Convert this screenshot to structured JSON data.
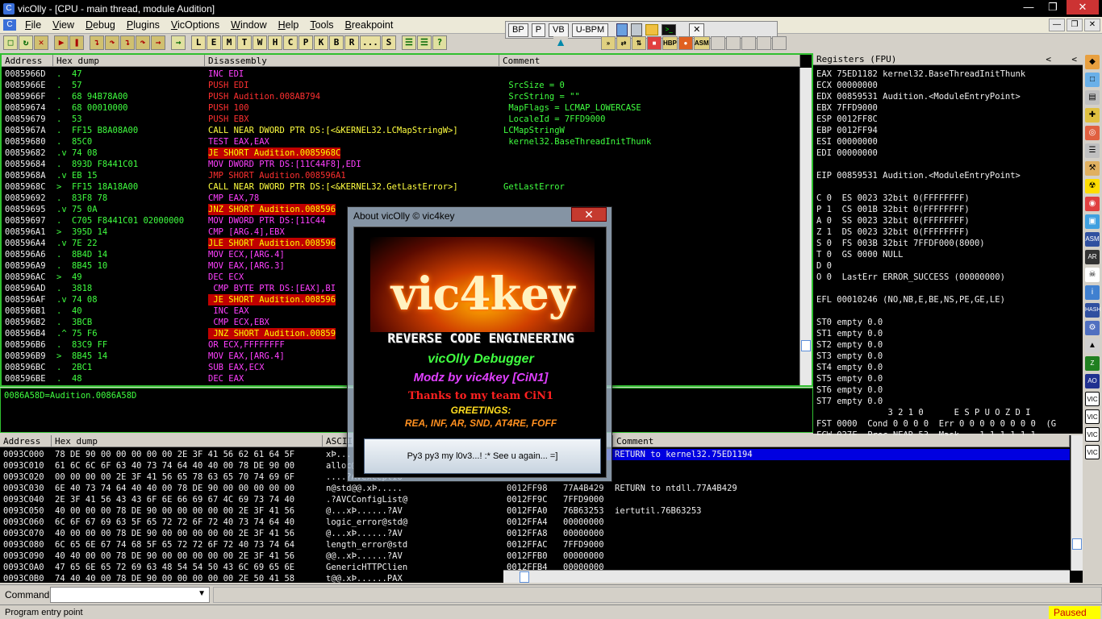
{
  "window": {
    "title": "vicOlly - [CPU - main thread, module Audition]"
  },
  "menu": [
    "File",
    "View",
    "Debug",
    "Plugins",
    "VicOptions",
    "Window",
    "Help",
    "Tools",
    "Breakpoint"
  ],
  "toolbar": {
    "buttons": [
      "L",
      "E",
      "M",
      "T",
      "W",
      "H",
      "C",
      "P",
      "K",
      "B",
      "R",
      "...",
      "S"
    ]
  },
  "floatbar": [
    "BP",
    "P",
    "VB",
    "U-BPM"
  ],
  "toolbar2": [
    "HBP",
    "ASM"
  ],
  "cpu": {
    "headers": {
      "address": "Address",
      "hex": "Hex dump",
      "disasm": "Disassembly",
      "comment": "Comment"
    },
    "rows": [
      {
        "addr": "0085966D",
        "hex": ".  47",
        "asm": "INC EDI",
        "cmt": ""
      },
      {
        "addr": "0085966E",
        "hex": ".  57",
        "asm": "PUSH EDI",
        "cmt": " SrcSize = 0"
      },
      {
        "addr": "0085966F",
        "hex": ".  68 94B78A00",
        "asm": "PUSH Audition.008AB794",
        "cmt": " SrcString = \"\""
      },
      {
        "addr": "00859674",
        "hex": ".  68 00010000",
        "asm": "PUSH 100",
        "cmt": " MapFlags = LCMAP_LOWERCASE"
      },
      {
        "addr": "00859679",
        "hex": ".  53",
        "asm": "PUSH EBX",
        "cmt": " LocaleId = 7FFD9000"
      },
      {
        "addr": "0085967A",
        "hex": ".  FF15 B8A08A00",
        "asm": "CALL NEAR DWORD PTR DS:[<&KERNEL32.LCMapStringW>]",
        "cmt": "LCMapStringW"
      },
      {
        "addr": "00859680",
        "hex": ".  85C0",
        "asm": "TEST EAX,EAX",
        "cmt": " kernel32.BaseThreadInitThunk"
      },
      {
        "addr": "00859682",
        "hex": ".v 74 08",
        "asm": "JE SHORT Audition.0085968C",
        "cmt": ""
      },
      {
        "addr": "00859684",
        "hex": ".  893D F8441C01",
        "asm": "MOV DWORD PTR DS:[11C44F8],EDI",
        "cmt": ""
      },
      {
        "addr": "0085968A",
        "hex": ".v EB 15",
        "asm": "JMP SHORT Audition.008596A1",
        "cmt": ""
      },
      {
        "addr": "0085968C",
        "hex": ">  FF15 18A18A00",
        "asm": "CALL NEAR DWORD PTR DS:[<&KERNEL32.GetLastError>]",
        "cmt": "GetLastError"
      },
      {
        "addr": "00859692",
        "hex": ".  83F8 78",
        "asm": "CMP EAX,78",
        "cmt": ""
      },
      {
        "addr": "00859695",
        "hex": ".v 75 0A",
        "asm": "JNZ SHORT Audition.008596",
        "cmt": ""
      },
      {
        "addr": "00859697",
        "hex": ".  C705 F8441C01 02000000",
        "asm": "MOV DWORD PTR DS:[11C44",
        "cmt": ""
      },
      {
        "addr": "008596A1",
        "hex": ">  395D 14",
        "asm": "CMP [ARG.4],EBX",
        "cmt": ""
      },
      {
        "addr": "008596A4",
        "hex": ".v 7E 22",
        "asm": "JLE SHORT Audition.008596",
        "cmt": ""
      },
      {
        "addr": "008596A6",
        "hex": ".  8B4D 14",
        "asm": "MOV ECX,[ARG.4]",
        "cmt": ""
      },
      {
        "addr": "008596A9",
        "hex": ".  8B45 10",
        "asm": "MOV EAX,[ARG.3]",
        "cmt": ""
      },
      {
        "addr": "008596AC",
        "hex": ">  49",
        "asm": "DEC ECX",
        "cmt": ""
      },
      {
        "addr": "008596AD",
        "hex": ".  3818",
        "asm": " CMP BYTE PTR DS:[EAX],BI",
        "cmt": ""
      },
      {
        "addr": "008596AF",
        "hex": ".v 74 08",
        "asm": " JE SHORT Audition.008596",
        "cmt": "InitThunk"
      },
      {
        "addr": "008596B1",
        "hex": ".  40",
        "asm": " INC EAX",
        "cmt": ""
      },
      {
        "addr": "008596B2",
        "hex": ".  3BCB",
        "asm": " CMP ECX,EBX",
        "cmt": ""
      },
      {
        "addr": "008596B4",
        "hex": ".^ 75 F6",
        "asm": " JNZ SHORT Audition.00859",
        "cmt": ""
      },
      {
        "addr": "008596B6",
        "hex": ".  83C9 FF",
        "asm": "OR ECX,FFFFFFFF",
        "cmt": ""
      },
      {
        "addr": "008596B9",
        "hex": ">  8B45 14",
        "asm": "MOV EAX,[ARG.4]",
        "cmt": ""
      },
      {
        "addr": "008596BC",
        "hex": ".  2BC1",
        "asm": "SUB EAX,ECX",
        "cmt": ""
      },
      {
        "addr": "008596BE",
        "hex": ".  48",
        "asm": "DEC EAX",
        "cmt": "InitThunk"
      }
    ],
    "info": "0086A58D=Audition.0086A58D"
  },
  "registers": {
    "header": "Registers (FPU)",
    "lines": [
      "EAX 75ED1182 kernel32.BaseThreadInitThunk",
      "ECX 00000000",
      "EDX 00859531 Audition.<ModuleEntryPoint>",
      "EBX 7FFD9000",
      "ESP 0012FF8C",
      "EBP 0012FF94",
      "ESI 00000000",
      "EDI 00000000",
      "",
      "EIP 00859531 Audition.<ModuleEntryPoint>",
      "",
      "C 0  ES 0023 32bit 0(FFFFFFFF)",
      "P 1  CS 001B 32bit 0(FFFFFFFF)",
      "A 0  SS 0023 32bit 0(FFFFFFFF)",
      "Z 1  DS 0023 32bit 0(FFFFFFFF)",
      "S 0  FS 003B 32bit 7FFDF000(8000)",
      "T 0  GS 0000 NULL",
      "D 0",
      "O 0  LastErr ERROR_SUCCESS (00000000)",
      "",
      "EFL 00010246 (NO,NB,E,BE,NS,PE,GE,LE)",
      "",
      "ST0 empty 0.0",
      "ST1 empty 0.0",
      "ST2 empty 0.0",
      "ST3 empty 0.0",
      "ST4 empty 0.0",
      "ST5 empty 0.0",
      "ST6 empty 0.0",
      "ST7 empty 0.0",
      "              3 2 1 0      E S P U O Z D I",
      "FST 0000  Cond 0 0 0 0  Err 0 0 0 0 0 0 0 0  (G",
      "FCW 027F  Prec NEAR,53  Mask    1 1 1 1 1 1"
    ]
  },
  "dump": {
    "headers": {
      "address": "Address",
      "hex": "Hex dump",
      "ascii": "ASCII"
    },
    "rows": [
      {
        "addr": "0093C000",
        "hex": "78 DE 90 00 00 00 00 00 2E 3F 41 56 62 61 64 5F",
        "ascii": "xÞ.....?AVbad_"
      },
      {
        "addr": "0093C010",
        "hex": "61 6C 6C 6F 63 40 73 74 64 40 40 00 78 DE 90 00",
        "ascii": "alloc@std@@.xÞ."
      },
      {
        "addr": "0093C020",
        "hex": "00 00 00 00 2E 3F 41 56 65 78 63 65 70 74 69 6F",
        "ascii": "....?AVexceptio"
      },
      {
        "addr": "0093C030",
        "hex": "6E 40 73 74 64 40 40 00 78 DE 90 00 00 00 00 00",
        "ascii": "n@std@@.xÞ....."
      },
      {
        "addr": "0093C040",
        "hex": "2E 3F 41 56 43 43 6F 6E 66 69 67 4C 69 73 74 40",
        "ascii": ".?AVCConfigList@"
      },
      {
        "addr": "0093C050",
        "hex": "40 00 00 00 78 DE 90 00 00 00 00 00 2E 3F 41 56",
        "ascii": "@...xÞ......?AV"
      },
      {
        "addr": "0093C060",
        "hex": "6C 6F 67 69 63 5F 65 72 72 6F 72 40 73 74 64 40",
        "ascii": "logic_error@std@"
      },
      {
        "addr": "0093C070",
        "hex": "40 00 00 00 78 DE 90 00 00 00 00 00 2E 3F 41 56",
        "ascii": "@...xÞ......?AV"
      },
      {
        "addr": "0093C080",
        "hex": "6C 65 6E 67 74 68 5F 65 72 72 6F 72 40 73 74 64",
        "ascii": "length_error@std"
      },
      {
        "addr": "0093C090",
        "hex": "40 40 00 00 78 DE 90 00 00 00 00 00 2E 3F 41 56",
        "ascii": "@@..xÞ......?AV"
      },
      {
        "addr": "0093C0A0",
        "hex": "47 65 6E 65 72 69 63 48 54 54 50 43 6C 69 65 6E",
        "ascii": "GenericHTTPClien"
      },
      {
        "addr": "0093C0B0",
        "hex": "74 40 40 00 78 DE 90 00 00 00 00 00 2E 50 41 58",
        "ascii": "t@@.xÞ......PAX"
      }
    ]
  },
  "stack": {
    "header": "Comment",
    "rows": [
      {
        "addr": "",
        "val": "",
        "cmt": "RETURN to kernel32.75ED1194",
        "sel": true
      },
      {
        "addr": "",
        "val": "",
        "cmt": "",
        "sel": false
      },
      {
        "addr": "",
        "val": "",
        "cmt": "",
        "sel": false
      },
      {
        "addr": "0012FF98",
        "val": "77A4B429",
        "cmt": "RETURN to ntdll.77A4B429",
        "sel": false
      },
      {
        "addr": "0012FF9C",
        "val": "7FFD9000",
        "cmt": "",
        "sel": false
      },
      {
        "addr": "0012FFA0",
        "val": "76B63253",
        "cmt": "iertutil.76B63253",
        "sel": false
      },
      {
        "addr": "0012FFA4",
        "val": "00000000",
        "cmt": "",
        "sel": false
      },
      {
        "addr": "0012FFA8",
        "val": "00000000",
        "cmt": "",
        "sel": false
      },
      {
        "addr": "0012FFAC",
        "val": "7FFD9000",
        "cmt": "",
        "sel": false
      },
      {
        "addr": "0012FFB0",
        "val": "00000000",
        "cmt": "",
        "sel": false
      },
      {
        "addr": "0012FFB4",
        "val": "00000000",
        "cmt": "",
        "sel": false
      }
    ]
  },
  "about": {
    "title": "About vicOlly © vic4key",
    "close": "✕",
    "logo": "vic4key",
    "lines": [
      "REVERSE CODE ENGINEERING",
      "vicOlly Debugger",
      "Modz by vic4key [CiN1]",
      "Thanks to my team CiN1",
      "GREETINGS:",
      "REA, INF, AR, SND, AT4RE, FOFF"
    ],
    "button": "Py3 py3 my l0v3...! :*  See u again... =]"
  },
  "command": {
    "label": "Command",
    "value": ""
  },
  "status": {
    "message": "Program entry point",
    "state": "Paused"
  }
}
